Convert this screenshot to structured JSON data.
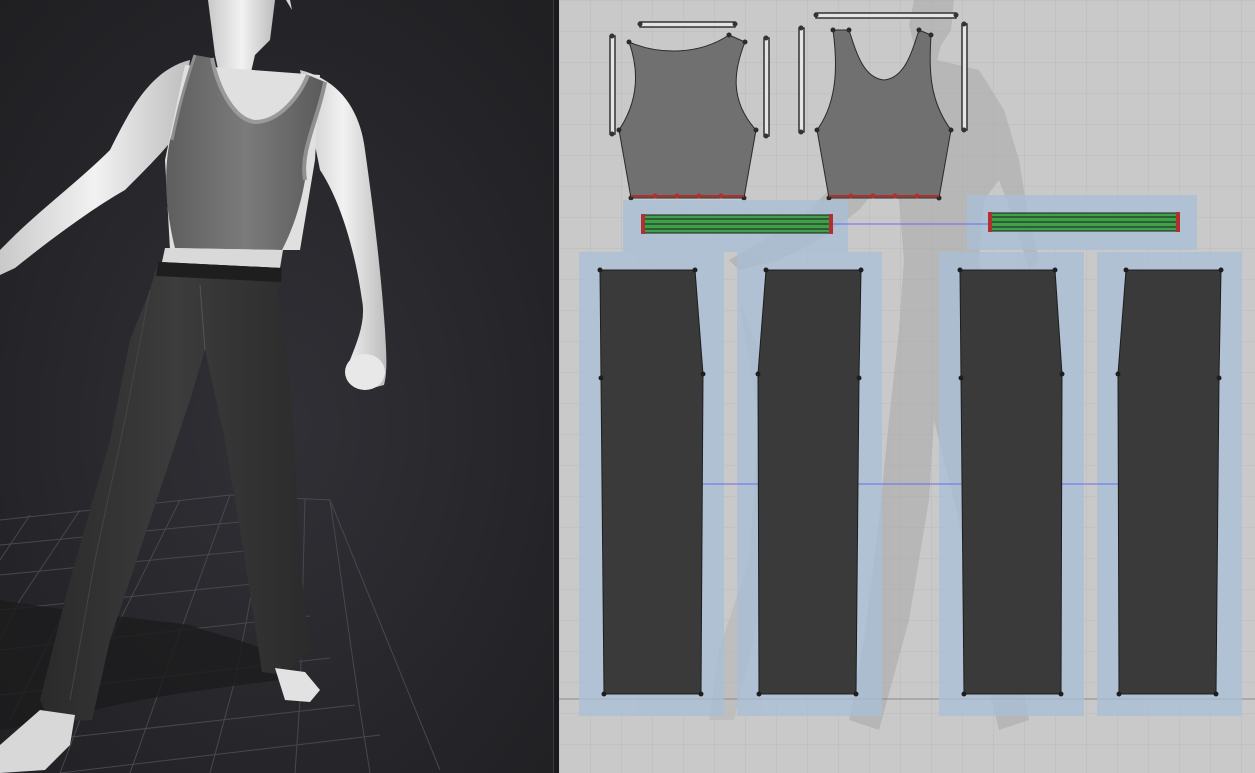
{
  "workspace": {
    "views": [
      "3d-viewport",
      "2d-pattern-window"
    ]
  },
  "viewport3d": {
    "avatar": "female-avatar",
    "garments": [
      "tank-top",
      "pants"
    ],
    "floor": "grid-floor"
  },
  "viewport2d": {
    "background": "avatar-silhouette",
    "patterns": [
      "top-front",
      "top-back",
      "waistband-left",
      "waistband-right",
      "leg-1",
      "leg-2",
      "leg-3",
      "leg-4"
    ]
  },
  "colors": {
    "bg3d": "#26262a",
    "bg2d": "#c9c9c9",
    "grid2d": "#bdbdbd",
    "top_piece": "#707070",
    "leg_piece": "#3a3a3a",
    "selection": "#a9bfd8",
    "waistband": "#3fa24a",
    "seam_point": "#b03030",
    "link_line": "#6a6af0"
  }
}
